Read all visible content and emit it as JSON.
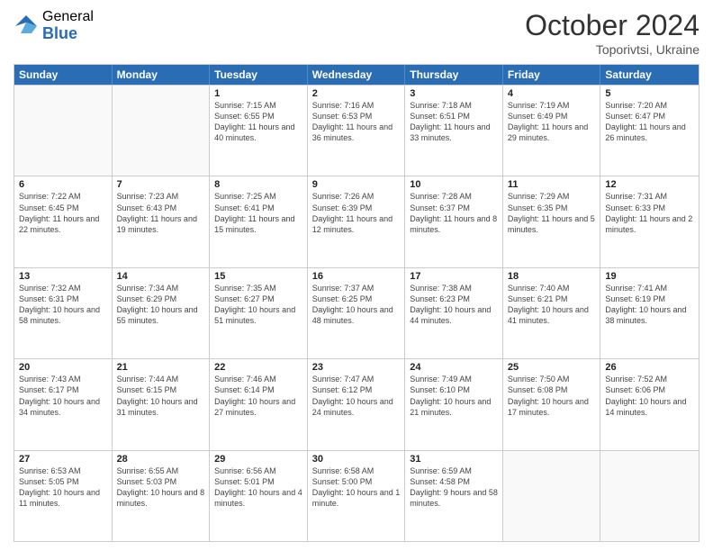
{
  "logo": {
    "general": "General",
    "blue": "Blue"
  },
  "header": {
    "month": "October 2024",
    "location": "Toporivtsi, Ukraine"
  },
  "weekdays": [
    "Sunday",
    "Monday",
    "Tuesday",
    "Wednesday",
    "Thursday",
    "Friday",
    "Saturday"
  ],
  "weeks": [
    [
      {
        "day": "",
        "empty": true
      },
      {
        "day": "",
        "empty": true
      },
      {
        "day": "1",
        "sunrise": "7:15 AM",
        "sunset": "6:55 PM",
        "daylight": "11 hours and 40 minutes."
      },
      {
        "day": "2",
        "sunrise": "7:16 AM",
        "sunset": "6:53 PM",
        "daylight": "11 hours and 36 minutes."
      },
      {
        "day": "3",
        "sunrise": "7:18 AM",
        "sunset": "6:51 PM",
        "daylight": "11 hours and 33 minutes."
      },
      {
        "day": "4",
        "sunrise": "7:19 AM",
        "sunset": "6:49 PM",
        "daylight": "11 hours and 29 minutes."
      },
      {
        "day": "5",
        "sunrise": "7:20 AM",
        "sunset": "6:47 PM",
        "daylight": "11 hours and 26 minutes."
      }
    ],
    [
      {
        "day": "6",
        "sunrise": "7:22 AM",
        "sunset": "6:45 PM",
        "daylight": "11 hours and 22 minutes."
      },
      {
        "day": "7",
        "sunrise": "7:23 AM",
        "sunset": "6:43 PM",
        "daylight": "11 hours and 19 minutes."
      },
      {
        "day": "8",
        "sunrise": "7:25 AM",
        "sunset": "6:41 PM",
        "daylight": "11 hours and 15 minutes."
      },
      {
        "day": "9",
        "sunrise": "7:26 AM",
        "sunset": "6:39 PM",
        "daylight": "11 hours and 12 minutes."
      },
      {
        "day": "10",
        "sunrise": "7:28 AM",
        "sunset": "6:37 PM",
        "daylight": "11 hours and 8 minutes."
      },
      {
        "day": "11",
        "sunrise": "7:29 AM",
        "sunset": "6:35 PM",
        "daylight": "11 hours and 5 minutes."
      },
      {
        "day": "12",
        "sunrise": "7:31 AM",
        "sunset": "6:33 PM",
        "daylight": "11 hours and 2 minutes."
      }
    ],
    [
      {
        "day": "13",
        "sunrise": "7:32 AM",
        "sunset": "6:31 PM",
        "daylight": "10 hours and 58 minutes."
      },
      {
        "day": "14",
        "sunrise": "7:34 AM",
        "sunset": "6:29 PM",
        "daylight": "10 hours and 55 minutes."
      },
      {
        "day": "15",
        "sunrise": "7:35 AM",
        "sunset": "6:27 PM",
        "daylight": "10 hours and 51 minutes."
      },
      {
        "day": "16",
        "sunrise": "7:37 AM",
        "sunset": "6:25 PM",
        "daylight": "10 hours and 48 minutes."
      },
      {
        "day": "17",
        "sunrise": "7:38 AM",
        "sunset": "6:23 PM",
        "daylight": "10 hours and 44 minutes."
      },
      {
        "day": "18",
        "sunrise": "7:40 AM",
        "sunset": "6:21 PM",
        "daylight": "10 hours and 41 minutes."
      },
      {
        "day": "19",
        "sunrise": "7:41 AM",
        "sunset": "6:19 PM",
        "daylight": "10 hours and 38 minutes."
      }
    ],
    [
      {
        "day": "20",
        "sunrise": "7:43 AM",
        "sunset": "6:17 PM",
        "daylight": "10 hours and 34 minutes."
      },
      {
        "day": "21",
        "sunrise": "7:44 AM",
        "sunset": "6:15 PM",
        "daylight": "10 hours and 31 minutes."
      },
      {
        "day": "22",
        "sunrise": "7:46 AM",
        "sunset": "6:14 PM",
        "daylight": "10 hours and 27 minutes."
      },
      {
        "day": "23",
        "sunrise": "7:47 AM",
        "sunset": "6:12 PM",
        "daylight": "10 hours and 24 minutes."
      },
      {
        "day": "24",
        "sunrise": "7:49 AM",
        "sunset": "6:10 PM",
        "daylight": "10 hours and 21 minutes."
      },
      {
        "day": "25",
        "sunrise": "7:50 AM",
        "sunset": "6:08 PM",
        "daylight": "10 hours and 17 minutes."
      },
      {
        "day": "26",
        "sunrise": "7:52 AM",
        "sunset": "6:06 PM",
        "daylight": "10 hours and 14 minutes."
      }
    ],
    [
      {
        "day": "27",
        "sunrise": "6:53 AM",
        "sunset": "5:05 PM",
        "daylight": "10 hours and 11 minutes."
      },
      {
        "day": "28",
        "sunrise": "6:55 AM",
        "sunset": "5:03 PM",
        "daylight": "10 hours and 8 minutes."
      },
      {
        "day": "29",
        "sunrise": "6:56 AM",
        "sunset": "5:01 PM",
        "daylight": "10 hours and 4 minutes."
      },
      {
        "day": "30",
        "sunrise": "6:58 AM",
        "sunset": "5:00 PM",
        "daylight": "10 hours and 1 minute."
      },
      {
        "day": "31",
        "sunrise": "6:59 AM",
        "sunset": "4:58 PM",
        "daylight": "9 hours and 58 minutes."
      },
      {
        "day": "",
        "empty": true
      },
      {
        "day": "",
        "empty": true
      }
    ]
  ]
}
